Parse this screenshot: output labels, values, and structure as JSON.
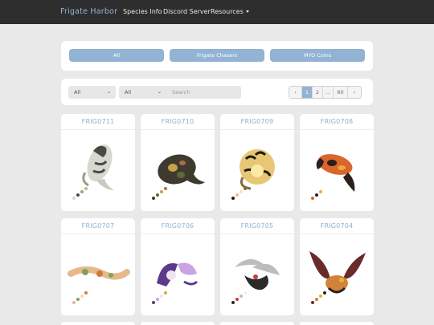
{
  "navbar": {
    "brand": "Frigate Harbor",
    "links": [
      "Species Info",
      "Discord Server",
      "Resources"
    ]
  },
  "categories": [
    "All",
    "Frigate Chasers",
    "MYO Coins"
  ],
  "filters": {
    "select_1": "All",
    "select_2": "All",
    "search_placeholder": "Search"
  },
  "pagination": {
    "prev": "‹",
    "pages": [
      "1",
      "2",
      "...",
      "60"
    ],
    "current": "1",
    "next": "›"
  },
  "cards": [
    {
      "code": "FRIG0711",
      "palette": [
        "#d8d8d0",
        "#4a4a44",
        "#8fa88a",
        "#c9b884"
      ]
    },
    {
      "code": "FRIG0710",
      "palette": [
        "#3e3a2e",
        "#5b6a3a",
        "#c7a24a",
        "#a96d4a"
      ]
    },
    {
      "code": "FRIG0709",
      "palette": [
        "#1f1c17",
        "#e8c774",
        "#fbe9a6",
        "#8a6a40"
      ]
    },
    {
      "code": "FRIG0708",
      "palette": [
        "#d9662a",
        "#2c1f1c",
        "#f2a441",
        "#ffffff"
      ]
    },
    {
      "code": "FRIG0707",
      "palette": [
        "#e7b88a",
        "#7fa35a",
        "#f6d7b0",
        "#cf7a3d"
      ]
    },
    {
      "code": "FRIG0706",
      "palette": [
        "#5b3a8a",
        "#c9a3e2",
        "#efe3f4",
        "#e8a040"
      ]
    },
    {
      "code": "FRIG0705",
      "palette": [
        "#2b2b2b",
        "#c53d3d",
        "#bdbdbd",
        "#f1f1f1"
      ]
    },
    {
      "code": "FRIG0704",
      "palette": [
        "#6a2a2a",
        "#d1823b",
        "#e6b33a",
        "#2a1e1e"
      ]
    }
  ],
  "colors": {
    "navbar_bg": "#2e2e2e",
    "accent": "#92b3d3",
    "page_bg": "#e9e9e9"
  }
}
